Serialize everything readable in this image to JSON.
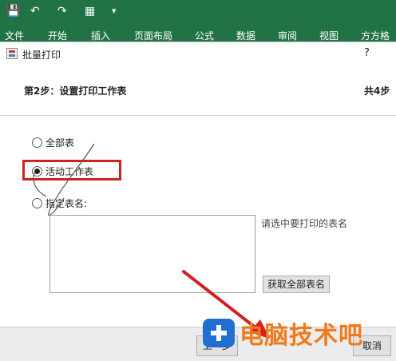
{
  "ribbon": {
    "quick_access": {
      "save_icon": "save-icon",
      "undo_icon": "undo-icon",
      "redo_icon": "redo-icon",
      "form_icon": "form-icon",
      "customize_icon": "customize-icon"
    },
    "tabs": [
      "文件",
      "开始",
      "插入",
      "页面布局",
      "公式",
      "数据",
      "审阅",
      "视图",
      "方方格"
    ]
  },
  "dialog": {
    "title": "批量打印",
    "help": "?",
    "step_title": "第2步：设置打印工作表",
    "step_total": "共4步",
    "options": [
      {
        "label": "全部表",
        "selected": false
      },
      {
        "label": "活动工作表",
        "selected": true
      },
      {
        "label": "指定表名:",
        "selected": false
      }
    ],
    "sheet_list_hint": "请选中要打印的表名",
    "fetch_button": "获取全部表名",
    "footer": {
      "prev_button": "上一步",
      "cancel_button": "取消"
    }
  },
  "watermark": {
    "text": "电脑技术吧"
  },
  "colors": {
    "ribbon": "#217346",
    "highlight": "#d42020",
    "arrow": "#d42020",
    "watermark_text": "#f07a1a",
    "watermark_logo": "#1f6fd1"
  }
}
